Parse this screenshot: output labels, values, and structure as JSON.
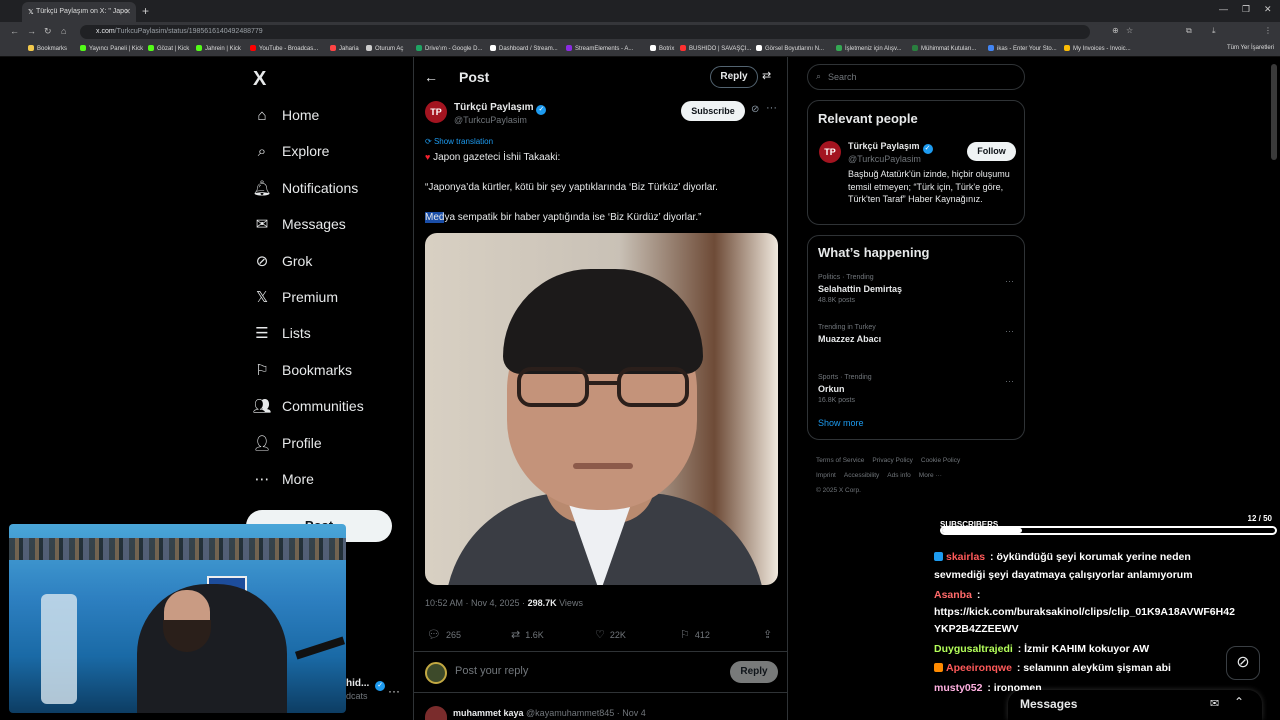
{
  "browser": {
    "tab_title": "Türkçü Paylaşım on X: \" Japo",
    "url_host": "x.com",
    "url_path": "/TurkcuPaylasim/status/1985616140492488779",
    "bookmarks": [
      "Bookmarks",
      "Yayıncı Paneli | Kick",
      "Gözat | Kick",
      "Jahrein | Kick",
      "YouTube - Broadcas...",
      "Jaharia",
      "Oturum Aç",
      "Drive'ım - Google D...",
      "Dashboard / Stream...",
      "StreamElements - A...",
      "Botrix",
      "BUSHIDO | SAVAŞÇI...",
      "Görsel Boyutlarını N...",
      "İşletmeniz için Alışv...",
      "Mühimmat Kutuları...",
      "ikas - Enter Your Sto...",
      "My Invoices - Invoic..."
    ],
    "all_bookmarks": "Tüm Yer İşaretleri"
  },
  "nav": {
    "logo": "X",
    "items": [
      {
        "label": "Home",
        "icon": "home-icon"
      },
      {
        "label": "Explore",
        "icon": "search-icon"
      },
      {
        "label": "Notifications",
        "icon": "bell-icon"
      },
      {
        "label": "Messages",
        "icon": "mail-icon"
      },
      {
        "label": "Grok",
        "icon": "grok-icon"
      },
      {
        "label": "Premium",
        "icon": "x-icon"
      },
      {
        "label": "Lists",
        "icon": "list-icon"
      },
      {
        "label": "Bookmarks",
        "icon": "bookmark-icon"
      },
      {
        "label": "Communities",
        "icon": "people-icon"
      },
      {
        "label": "Profile",
        "icon": "person-icon"
      },
      {
        "label": "More",
        "icon": "more-circle-icon"
      }
    ],
    "post_button": "Post",
    "account_name_peek": "hid...",
    "account_handle_peek": "dcats"
  },
  "post": {
    "header_title": "Post",
    "header_reply": "Reply",
    "author_name": "Türkçü Paylaşım",
    "author_handle": "@TurkcuPaylasim",
    "subscribe": "Subscribe",
    "show_translation": "Show translation",
    "line1": "Japon gazeteci İshii Takaaki:",
    "line2": "“Japonya’da kürtler, kötü bir şey yaptıklarında ‘Biz Türküz’ diyorlar.",
    "line3_highlight": "Med",
    "line3_rest": "ya sempatik bir haber yaptığında ise ‘Biz Kürdüz’ diyorlar.”",
    "time": "10:52 AM · Nov 4, 2025 · ",
    "views_count": "298.7K",
    "views_label": " Views",
    "replies": "265",
    "reposts": "1.6K",
    "likes": "22K",
    "bookmarks": "412",
    "reply_placeholder": "Post your reply",
    "reply_button": "Reply",
    "next_reply_name": "muhammet kaya",
    "next_reply_meta": " @kayamuhammet845 · Nov 4"
  },
  "sidebar": {
    "search_placeholder": "Search",
    "relevant_title": "Relevant people",
    "rp_name": "Türkçü Paylaşım",
    "rp_handle": "@TurkcuPaylasim",
    "rp_follow": "Follow",
    "rp_bio": "Başbuğ Atatürk'ün izinde, hiçbir oluşumu temsil etmeyen; “Türk için, Türk'e göre, Türk'ten Taraf” Haber Kaynağınız.",
    "happening_title": "What’s happening",
    "trends": [
      {
        "context": "Politics · Trending",
        "title": "Selahattin Demirtaş",
        "posts": "48.8K posts"
      },
      {
        "context": "Trending in Turkey",
        "title": "Muazzez Abacı",
        "posts": ""
      },
      {
        "context": "Sports · Trending",
        "title": "Orkun",
        "posts": "16.8K posts"
      }
    ],
    "show_more": "Show more",
    "footer_links": [
      "Terms of Service",
      "Privacy Policy",
      "Cookie Policy",
      "Imprint",
      "Accessibility",
      "Ads info",
      "More ···"
    ],
    "copyright": "© 2025 X Corp."
  },
  "stream": {
    "subs_label": "SUBSCRIBERS",
    "subs_count": "12",
    "subs_total": "/ 50",
    "subs_progress": 0.24,
    "chat": [
      {
        "user": "skairlas",
        "color": "#ff5a5a",
        "text": " : öykündüğü şeyi korumak yerine neden"
      },
      {
        "user": "",
        "color": "#ffffff",
        "text": "sevmediği şeyi dayatmaya çalışıyorlar anlamıyorum"
      },
      {
        "user": "Asanba",
        "color": "#ff6a6a",
        "text": " :"
      },
      {
        "user": "",
        "color": "#ffffff",
        "text": "https://kick.com/buraksakinol/clips/clip_01K9A18AVWF6H42"
      },
      {
        "user": "",
        "color": "#ffffff",
        "text": "YKP2B4ZZEEWV"
      },
      {
        "user": "Duygusaltrajedi",
        "color": "#b4ff5a",
        "text": " : İzmir KAHIM kokuyor AW"
      },
      {
        "user": "Apeeironqwe",
        "color": "#ff5a5a",
        "text": " : selamınn aleyküm şişman abi"
      },
      {
        "user": "musty052",
        "color": "#ffb0e0",
        "text": " : ironomen"
      }
    ],
    "messages_label": "Messages"
  }
}
